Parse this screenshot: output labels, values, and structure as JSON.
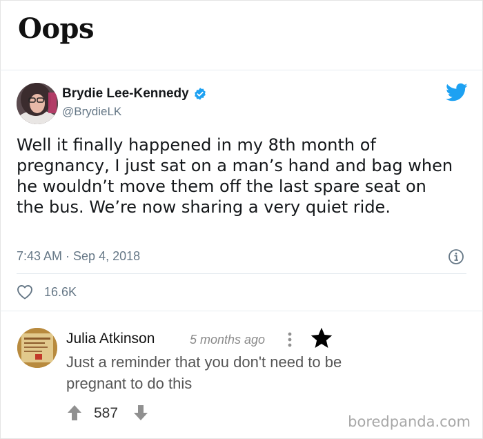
{
  "header": {
    "title": "Oops"
  },
  "tweet": {
    "author_name": "Brydie Lee-Kennedy",
    "author_handle": "@BrydieLK",
    "verified": true,
    "text": "Well it finally happened in my 8th month of pregnancy, I just sat on a man’s hand and bag when he wouldn’t move them off the last spare seat on the bus. We’re now sharing a very quiet ride.",
    "timestamp": "7:43 AM · Sep 4, 2018",
    "likes": "16.6K",
    "brand_color": "#1da1f2",
    "icons": [
      "twitter-bird-icon",
      "verified-badge-icon",
      "info-icon",
      "heart-icon"
    ]
  },
  "comment": {
    "author": "Julia Atkinson",
    "time": "5 months ago",
    "text": "Just a reminder that you don't need to be pregnant to do this",
    "votes": "587",
    "icons": [
      "kebab-menu-icon",
      "star-icon",
      "upvote-arrow-icon",
      "downvote-arrow-icon"
    ]
  },
  "watermark": "boredpanda.com"
}
